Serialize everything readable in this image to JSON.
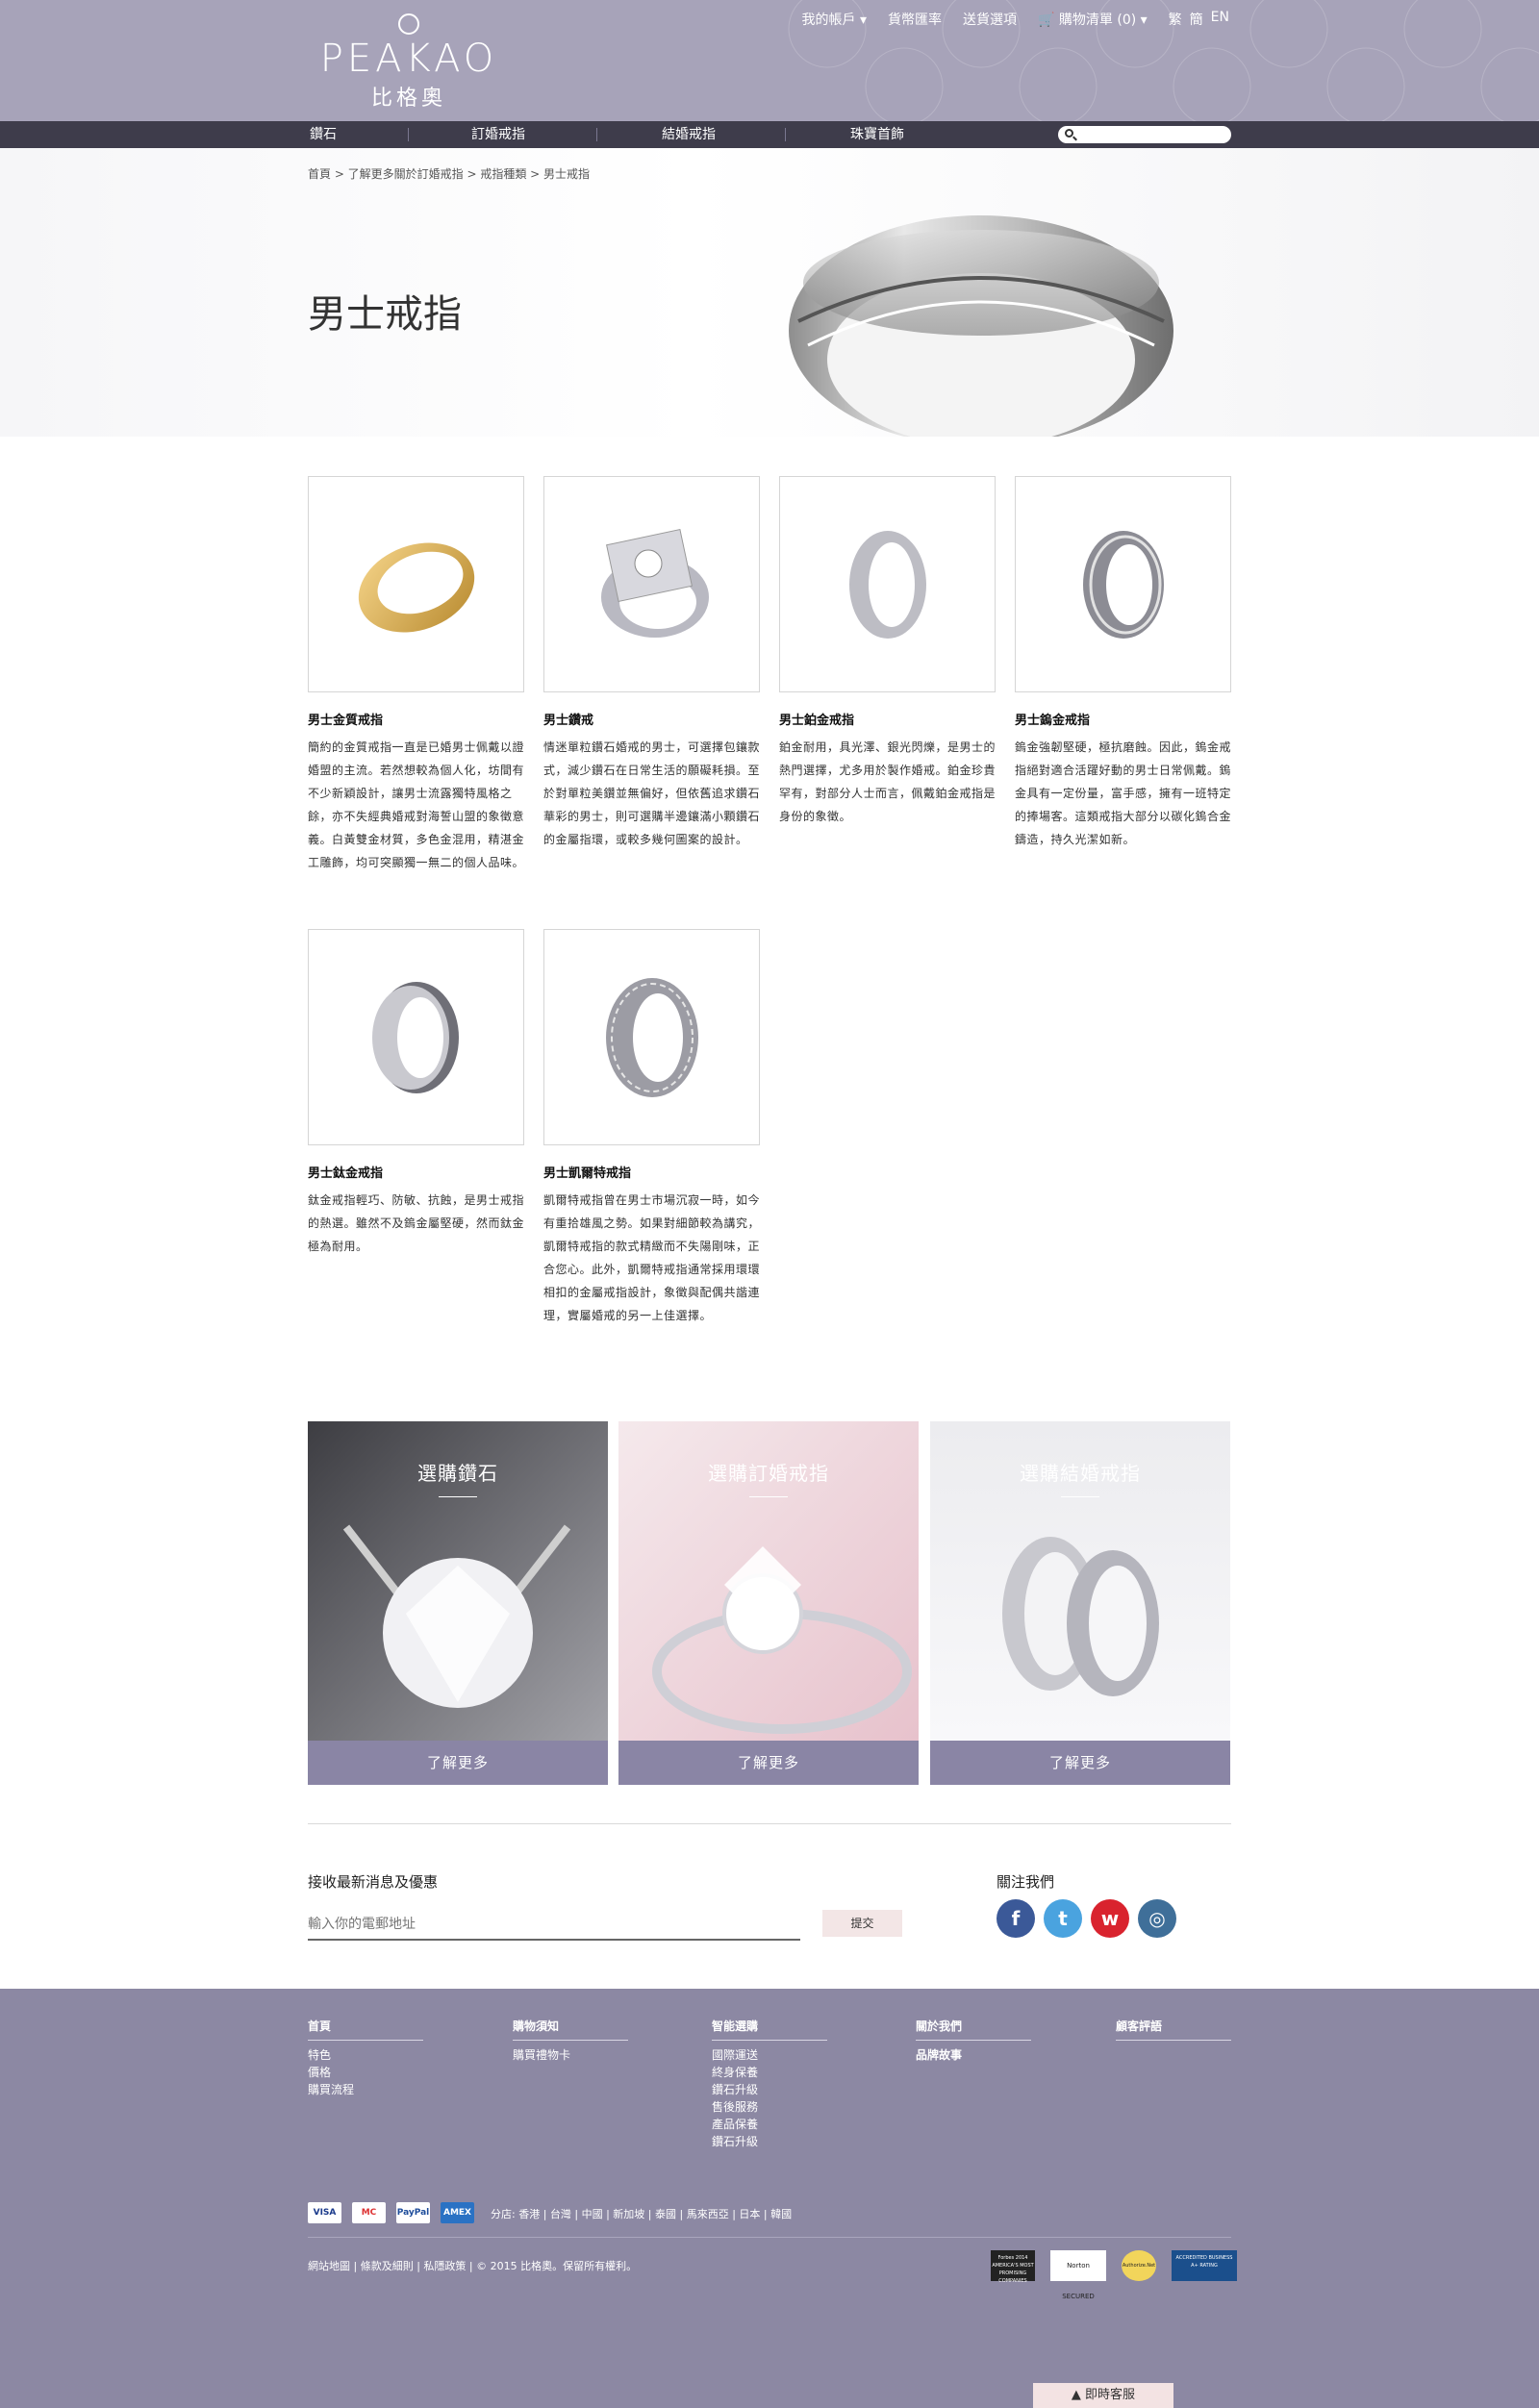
{
  "brand": {
    "name_en": "PEAKAO",
    "name_zh": "比格奧"
  },
  "toplinks": [
    "我的帳戶 ▾",
    "貨幣匯率",
    "送貨選項",
    "🛒 購物清單 (0) ▾",
    "繁",
    "簡",
    "EN"
  ],
  "nav": {
    "items": [
      "鑽石",
      "訂婚戒指",
      "結婚戒指",
      "珠寶首飾"
    ],
    "search_placeholder": ""
  },
  "hero": {
    "breadcrumb": "首頁  >  了解更多關於訂婚戒指  >  戒指種類  >  男士戒指",
    "title": "男士戒指"
  },
  "products": [
    {
      "name": "男士金質戒指",
      "desc": "簡約的金質戒指一直是已婚男士佩戴以證婚盟的主流。若然想較為個人化，坊間有不少新穎設計，讓男士流露獨特風格之餘，亦不失經典婚戒對海誓山盟的象徵意義。白黃雙金材質，多色金混用，精湛金工雕飾，均可突顯獨一無二的個人品味。",
      "metal": "gold"
    },
    {
      "name": "男士鑽戒",
      "desc": "情迷單粒鑽石婚戒的男士，可選擇包鑲款式，減少鑽石在日常生活的願礙耗損。至於對單粒美鑽並無偏好，但依舊追求鑽石華彩的男士，則可選購半邊鑲滿小顆鑽石的金屬指環，或較多幾何圖案的設計。",
      "metal": "diamond"
    },
    {
      "name": "男士鉑金戒指",
      "desc": "鉑金耐用，具光澤、銀光閃爍，是男士的熱門選擇，尤多用於製作婚戒。鉑金珍貴罕有，對部分人士而言，佩戴鉑金戒指是身份的象徵。",
      "metal": "platinum"
    },
    {
      "name": "男士鎢金戒指",
      "desc": "鎢金強韌堅硬，極抗磨蝕。因此，鎢金戒指絕對適合活躍好動的男士日常佩戴。鎢金具有一定份量，富手感，擁有一班特定的捧場客。這類戒指大部分以碳化鎢合金鑄造，持久光潔如新。",
      "metal": "tungsten"
    },
    {
      "name": "男士鈦金戒指",
      "desc": "鈦金戒指輕巧、防敏、抗蝕，是男士戒指的熱選。雖然不及鎢金屬堅硬，然而鈦金極為耐用。",
      "metal": "titanium"
    },
    {
      "name": "男士凱爾特戒指",
      "desc": "凱爾特戒指曾在男士市場沉寂一時，如今有重拾雄風之勢。如果對細節較為講究，凱爾特戒指的款式精緻而不失陽剛味，正合您心。此外，凱爾特戒指通常採用環環相扣的金屬戒指設計，象徵與配偶共諧連理，實屬婚戒的另一上佳選擇。",
      "metal": "celtic"
    }
  ],
  "promos": [
    {
      "title": "選購鑽石",
      "more": "了解更多"
    },
    {
      "title": "選購訂婚戒指",
      "more": "了解更多"
    },
    {
      "title": "選購結婚戒指",
      "more": "了解更多"
    }
  ],
  "newsletter": {
    "title": "接收最新消息及優惠",
    "placeholder": "輸入你的電郵地址",
    "submit": "提交"
  },
  "follow": {
    "title": "關注我們",
    "icons": [
      "facebook-icon",
      "twitter-icon",
      "weibo-icon",
      "instagram-icon"
    ]
  },
  "footer": {
    "cols": [
      {
        "head": "首頁",
        "items": [
          "特色",
          "價格",
          "購買流程"
        ]
      },
      {
        "head": "購物須知",
        "items": [
          "購買禮物卡"
        ]
      },
      {
        "head": "智能選購",
        "items": [
          "國際運送",
          "終身保養",
          "鑽石升級",
          "售後服務",
          "產品保養",
          "鑽石升級"
        ]
      },
      {
        "head": "關於我們",
        "items": [
          "品牌故事"
        ]
      },
      {
        "head": "顧客評語",
        "items": []
      }
    ],
    "payments": [
      "VISA",
      "MC",
      "PayPal",
      "AMEX"
    ],
    "branches": "分店: 香港 | 台灣 | 中國 | 新加坡 | 泰國 | 馬來西亞 | 日本 | 韓國",
    "copyright": "網站地圖 | 條款及細則  | 私隱政策 | © 2015 比格奧。保留所有權利。",
    "badges": [
      "Forbes 2014 AMERICA'S MOST PROMISING COMPANIES",
      "Norton SECURED",
      "Authorize.Net",
      "ACCREDITED BUSINESS A+ RATING"
    ]
  },
  "chat": "▲  即時客服",
  "colors": {
    "header": "#a7a3b9",
    "nav": "#3e3c4b",
    "accent": "#8a85a5",
    "footer": "#8c88a3"
  }
}
